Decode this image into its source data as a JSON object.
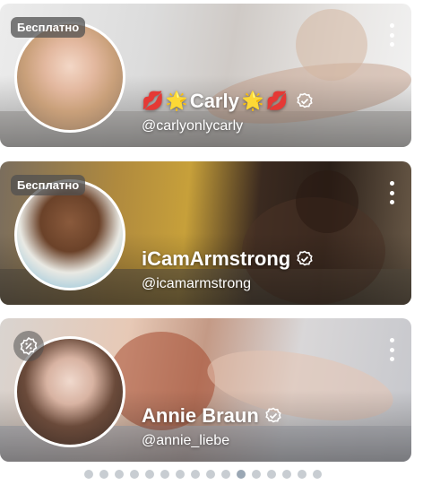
{
  "cards": [
    {
      "badge": "Бесплатно",
      "name": "Carly",
      "name_prefix_emojis": [
        "💋",
        "🌟"
      ],
      "name_suffix_emojis": [
        "🌟",
        "💋"
      ],
      "handle": "@carlyonlycarly",
      "verified_icon": "verified-badge-icon",
      "menu_icon": "more-vertical-icon"
    },
    {
      "badge": "Бесплатно",
      "name": "iCamArmstrong",
      "handle": "@icamarmstrong",
      "verified_icon": "verified-badge-icon",
      "menu_icon": "more-vertical-icon"
    },
    {
      "badge_icon": "discount-badge-icon",
      "name": "Annie Braun",
      "handle": "@annie_liebe",
      "verified_icon": "verified-badge-icon",
      "menu_icon": "more-vertical-icon"
    }
  ],
  "pagination": {
    "total": 16,
    "active_index": 10
  },
  "colors": {
    "dot": "#c8cdd2",
    "dot_active": "#9aa7b4",
    "badge_bg": "#505050"
  }
}
